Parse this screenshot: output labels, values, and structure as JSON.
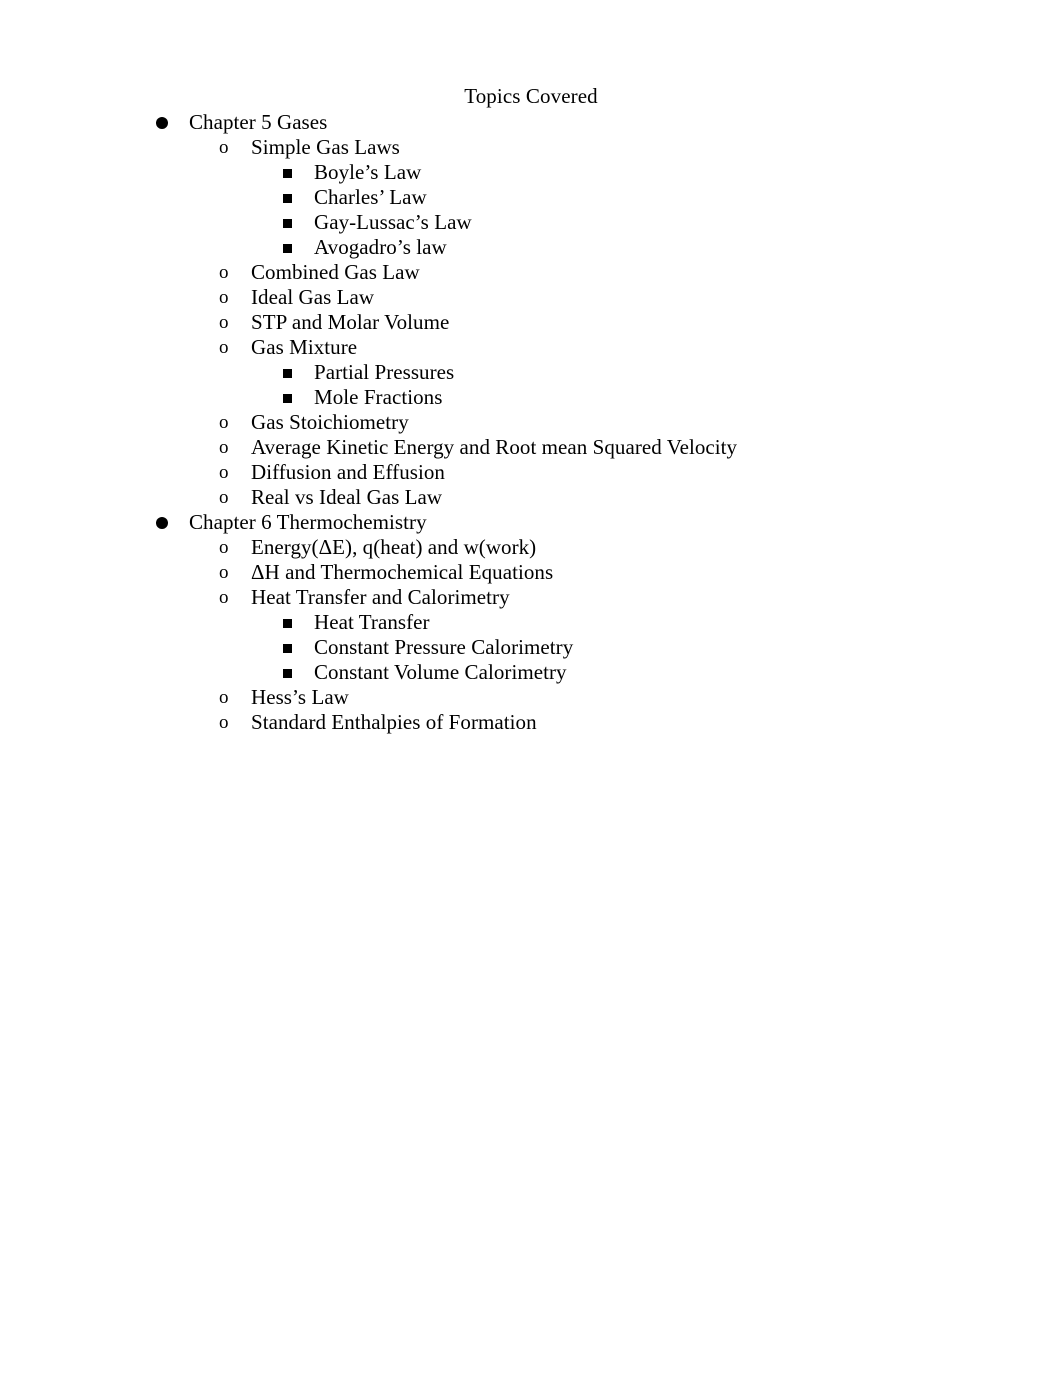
{
  "document": {
    "title": "Topics Covered",
    "markers": {
      "level1": "●",
      "level2": "o",
      "level3": "■"
    },
    "outline": [
      {
        "level": 1,
        "text": "Chapter 5 Gases"
      },
      {
        "level": 2,
        "text": "Simple Gas Laws"
      },
      {
        "level": 3,
        "text": "Boyle’s Law"
      },
      {
        "level": 3,
        "text": "Charles’ Law"
      },
      {
        "level": 3,
        "text": "Gay-Lussac’s Law"
      },
      {
        "level": 3,
        "text": "Avogadro’s law"
      },
      {
        "level": 2,
        "text": "Combined Gas Law"
      },
      {
        "level": 2,
        "text": "Ideal Gas Law"
      },
      {
        "level": 2,
        "text": "STP and Molar Volume"
      },
      {
        "level": 2,
        "text": "Gas Mixture"
      },
      {
        "level": 3,
        "text": "Partial Pressures"
      },
      {
        "level": 3,
        "text": "Mole Fractions"
      },
      {
        "level": 2,
        "text": "Gas Stoichiometry"
      },
      {
        "level": 2,
        "text": "Average Kinetic Energy and Root mean Squared Velocity"
      },
      {
        "level": 2,
        "text": "Diffusion and Effusion"
      },
      {
        "level": 2,
        "text": "Real vs Ideal Gas Law"
      },
      {
        "level": 1,
        "text": "Chapter 6 Thermochemistry"
      },
      {
        "level": 2,
        "text": "Energy(ΔE), q(heat) and w(work)"
      },
      {
        "level": 2,
        "text": "ΔH and Thermochemical Equations"
      },
      {
        "level": 2,
        "text": "Heat Transfer and Calorimetry"
      },
      {
        "level": 3,
        "text": "Heat Transfer"
      },
      {
        "level": 3,
        "text": "Constant Pressure Calorimetry"
      },
      {
        "level": 3,
        "text": "Constant Volume Calorimetry"
      },
      {
        "level": 2,
        "text": "Hess’s Law"
      },
      {
        "level": 2,
        "text": "Standard Enthalpies of Formation"
      }
    ]
  }
}
